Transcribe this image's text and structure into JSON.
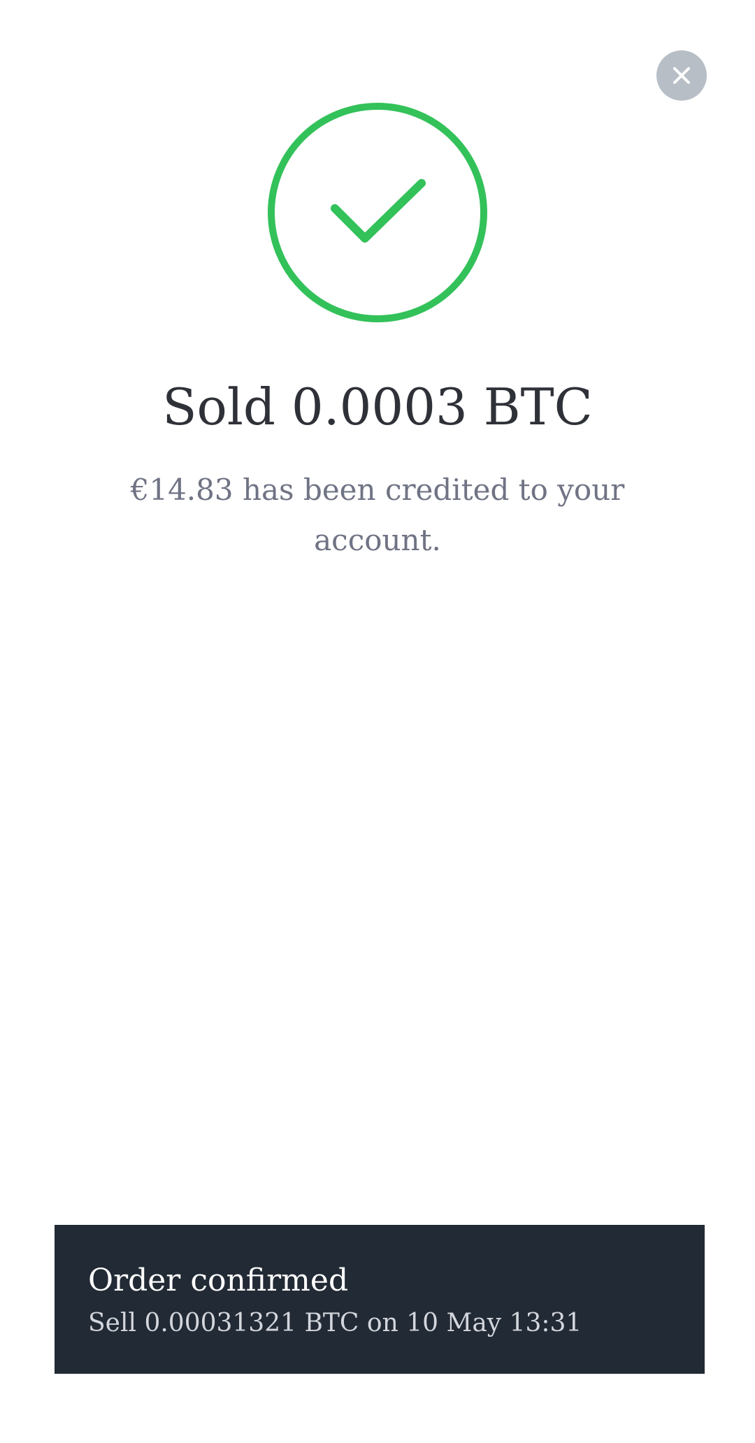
{
  "close": {
    "icon": "close-icon"
  },
  "success": {
    "icon": "check-circle-icon",
    "color": "#33c15a"
  },
  "title": "Sold 0.0003 BTC",
  "message": "€14.83 has been credited to your account.",
  "toast": {
    "title": "Order confirmed",
    "detail": "Sell 0.00031321 BTC on 10 May 13:31"
  },
  "colors": {
    "close_bg": "#b8bec6",
    "toast_bg": "#222a35",
    "title": "#2f3138",
    "message": "#6f7384"
  }
}
